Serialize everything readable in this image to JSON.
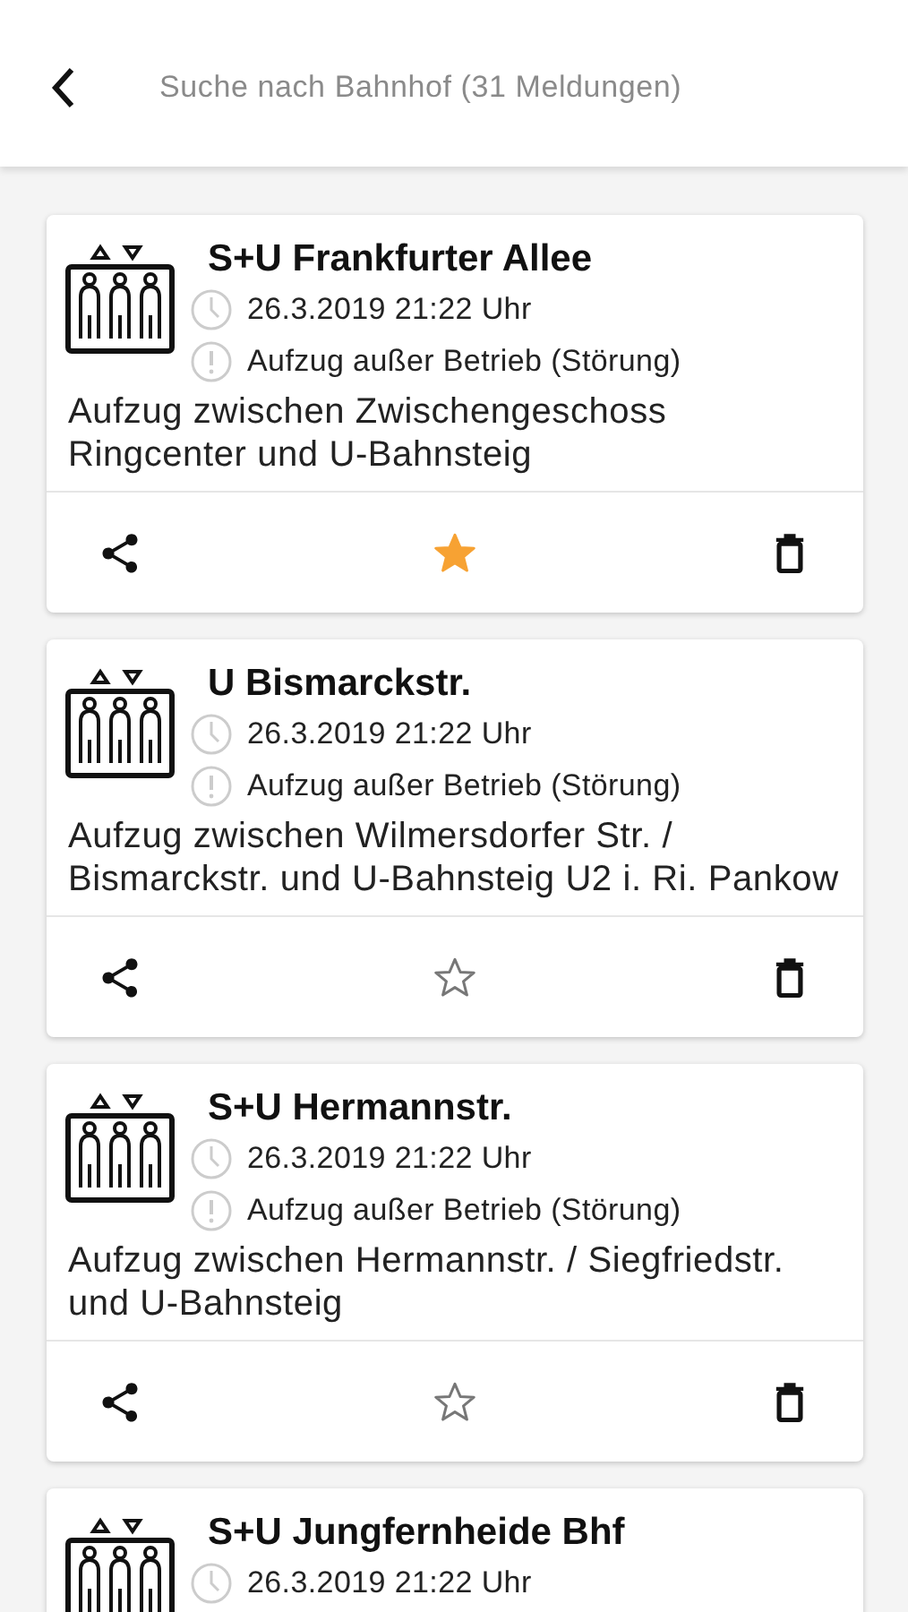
{
  "header": {
    "title": "Suche nach Bahnhof (31 Meldungen)"
  },
  "cards": [
    {
      "station": "S+U Frankfurter Allee",
      "time": "26.3.2019 21:22 Uhr",
      "status": "Aufzug außer Betrieb (Störung)",
      "description": "Aufzug zwischen Zwischengeschoss Ringcenter und U-Bahnsteig",
      "favorite": true
    },
    {
      "station": "U Bismarckstr.",
      "time": "26.3.2019 21:22 Uhr",
      "status": "Aufzug außer Betrieb (Störung)",
      "description": "Aufzug zwischen Wilmersdorfer Str. / Bismarckstr. und U-Bahnsteig U2 i. Ri. Pankow",
      "favorite": false
    },
    {
      "station": "S+U Hermannstr.",
      "time": "26.3.2019 21:22 Uhr",
      "status": "Aufzug außer Betrieb (Störung)",
      "description": "Aufzug zwischen Hermannstr. / Siegfriedstr. und U-Bahnsteig",
      "favorite": false
    },
    {
      "station": "S+U Jungfernheide Bhf",
      "time": "26.3.2019 21:22 Uhr"
    }
  ]
}
